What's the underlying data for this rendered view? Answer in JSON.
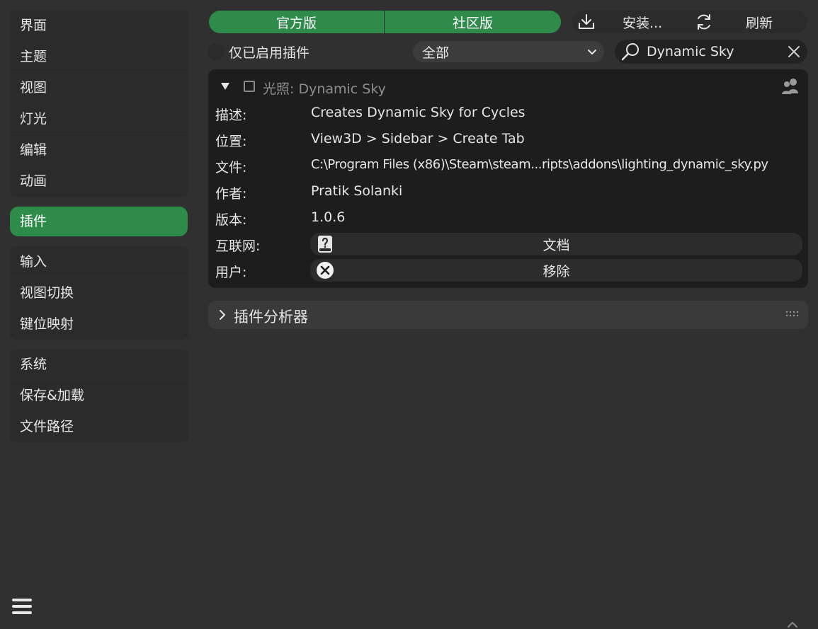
{
  "sidebar": {
    "group1": [
      {
        "label": "界面"
      },
      {
        "label": "主题"
      },
      {
        "label": "视图"
      },
      {
        "label": "灯光"
      },
      {
        "label": "编辑"
      },
      {
        "label": "动画"
      }
    ],
    "active": {
      "label": "插件"
    },
    "group2": [
      {
        "label": "输入"
      },
      {
        "label": "视图切换"
      },
      {
        "label": "键位映射"
      }
    ],
    "group3": [
      {
        "label": "系统"
      },
      {
        "label": "保存&加载"
      },
      {
        "label": "文件路径"
      }
    ],
    "menu_icon": "hamburger-icon"
  },
  "toolbar": {
    "official_label": "官方版",
    "community_label": "社区版",
    "install_label": "安装...",
    "refresh_label": "刷新",
    "install_icon": "download-icon",
    "refresh_icon": "refresh-icon"
  },
  "filter": {
    "enabled_only_label": "仅已启用插件",
    "category_value": "全部",
    "search_value": "Dynamic Sky"
  },
  "addon": {
    "title": "光照: Dynamic Sky",
    "rows": {
      "description": {
        "label": "描述:",
        "value": "Creates Dynamic Sky for Cycles"
      },
      "location": {
        "label": "位置:",
        "value": "View3D > Sidebar > Create Tab"
      },
      "file": {
        "label": "文件:",
        "value": "C:\\Program Files (x86)\\Steam\\steam...ripts\\addons\\lighting_dynamic_sky.py"
      },
      "author": {
        "label": "作者:",
        "value": "Pratik Solanki"
      },
      "version": {
        "label": "版本:",
        "value": "1.0.6"
      }
    },
    "internet": {
      "label": "互联网:",
      "button": "文档"
    },
    "user": {
      "label": "用户:",
      "button": "移除"
    }
  },
  "profiler": {
    "title": "插件分析器"
  },
  "colors": {
    "accent": "#2e8b4a",
    "background": "#303030",
    "panel": "#1d1d1d"
  }
}
